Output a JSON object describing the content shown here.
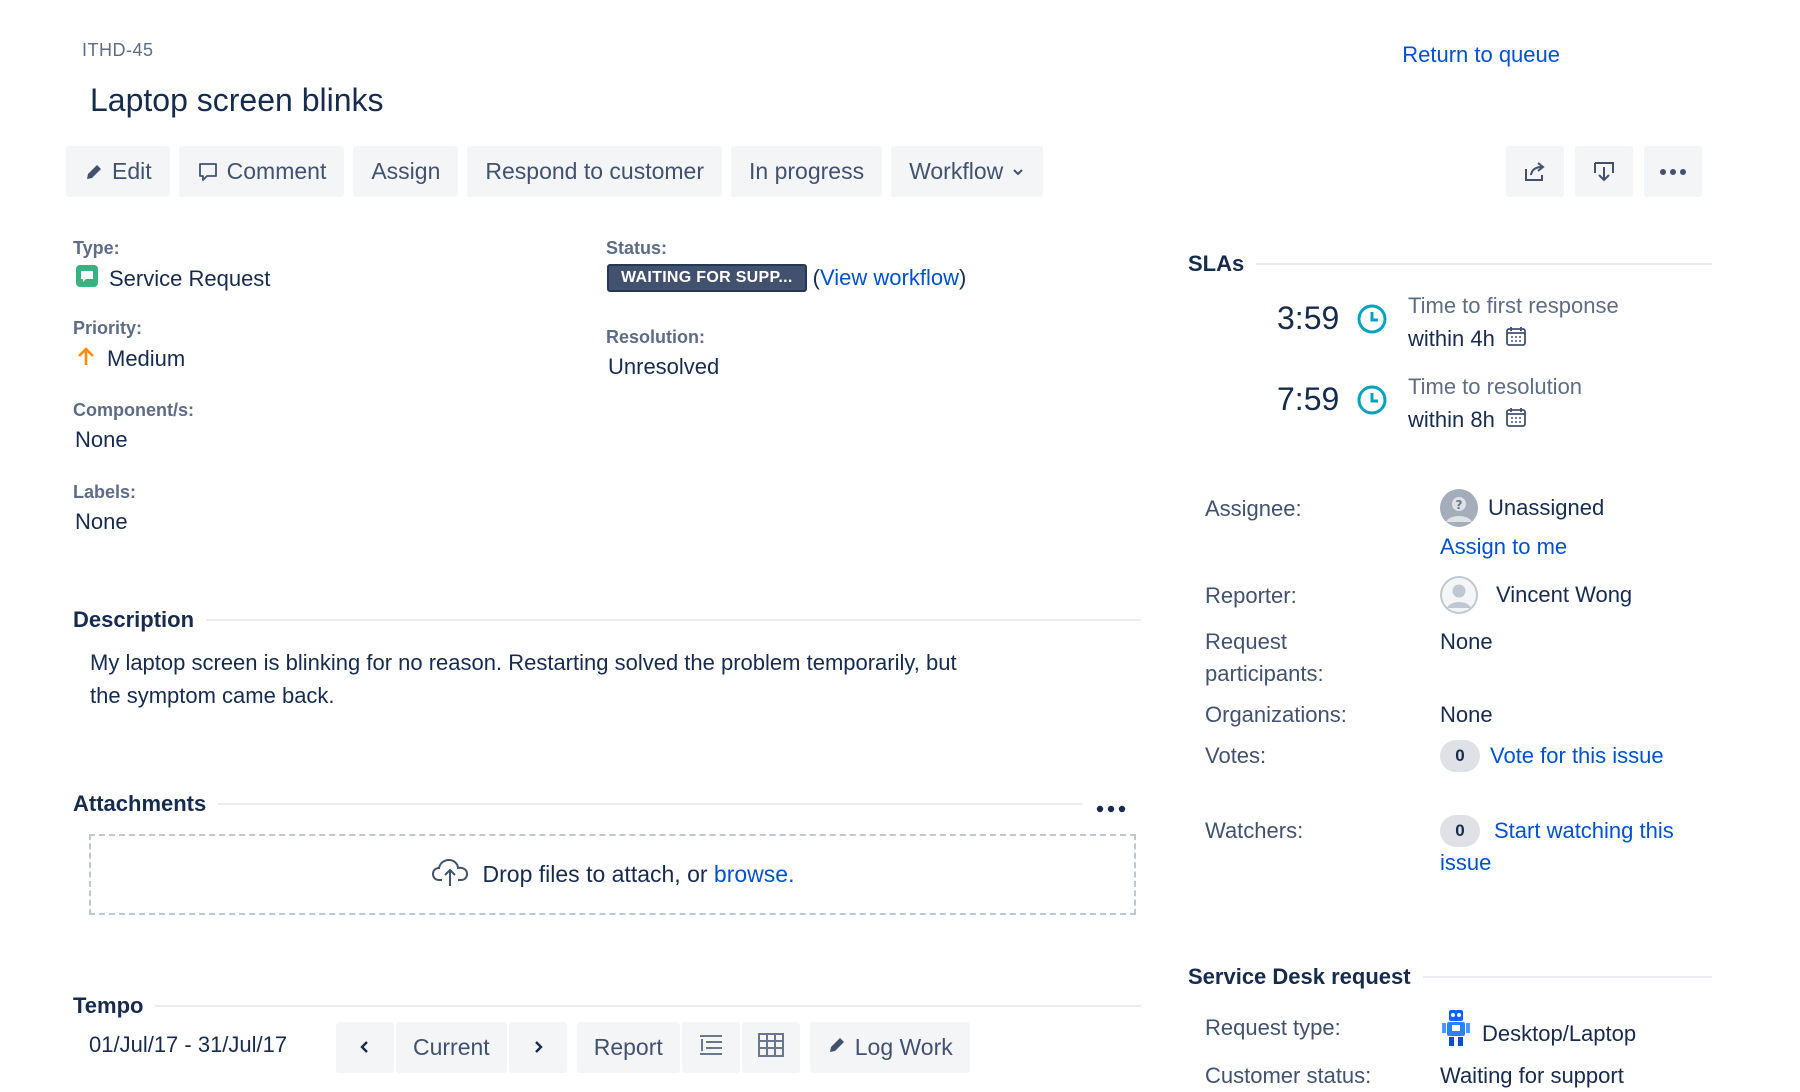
{
  "header": {
    "issue_key": "ITHD-45",
    "title": "Laptop screen blinks",
    "return_link": "Return to queue"
  },
  "toolbar": {
    "edit": "Edit",
    "comment": "Comment",
    "assign": "Assign",
    "respond": "Respond to customer",
    "in_progress": "In progress",
    "workflow": "Workflow"
  },
  "details": {
    "type_label": "Type:",
    "type_value": "Service Request",
    "priority_label": "Priority:",
    "priority_value": "Medium",
    "components_label": "Component/s:",
    "components_value": "None",
    "labels_label": "Labels:",
    "labels_value": "None",
    "status_label": "Status:",
    "status_value": "WAITING FOR SUPP...",
    "view_workflow_open": "(",
    "view_workflow": "View workflow",
    "view_workflow_close": ")",
    "resolution_label": "Resolution:",
    "resolution_value": "Unresolved"
  },
  "description": {
    "heading": "Description",
    "line1": "My laptop screen is blinking for no reason. Restarting solved the problem temporarily, but",
    "line2": "the symptom came back."
  },
  "attachments": {
    "heading": "Attachments",
    "drop_text": "Drop files to attach, or ",
    "browse": "browse."
  },
  "tempo": {
    "heading": "Tempo",
    "range": "01/Jul/17 - 31/Jul/17",
    "current": "Current",
    "report": "Report",
    "log_work": "Log Work"
  },
  "slas": {
    "heading": "SLAs",
    "items": [
      {
        "time": "3:59",
        "label": "Time to first response",
        "within": "within 4h"
      },
      {
        "time": "7:59",
        "label": "Time to resolution",
        "within": "within 8h"
      }
    ]
  },
  "people": {
    "assignee_label": "Assignee:",
    "assignee_value": "Unassigned",
    "assign_to_me": "Assign to me",
    "reporter_label": "Reporter:",
    "reporter_value": "Vincent Wong",
    "participants_label_1": "Request",
    "participants_label_2": "participants:",
    "participants_value": "None",
    "organizations_label": "Organizations:",
    "organizations_value": "None",
    "votes_label": "Votes:",
    "votes_count": "0",
    "vote_link": "Vote for this issue",
    "watchers_label": "Watchers:",
    "watchers_count": "0",
    "watch_link_1": "Start watching this",
    "watch_link_2": "issue"
  },
  "service_desk": {
    "heading": "Service Desk request",
    "request_type_label": "Request type:",
    "request_type_value": "Desktop/Laptop",
    "customer_status_label": "Customer status:",
    "customer_status_value": "Waiting for support"
  },
  "colors": {
    "link": "#0052cc",
    "sla_clock": "#00a3bf",
    "priority_medium": "#ff8b00",
    "service_request": "#36b37e",
    "status_lozenge": "#42526e"
  }
}
